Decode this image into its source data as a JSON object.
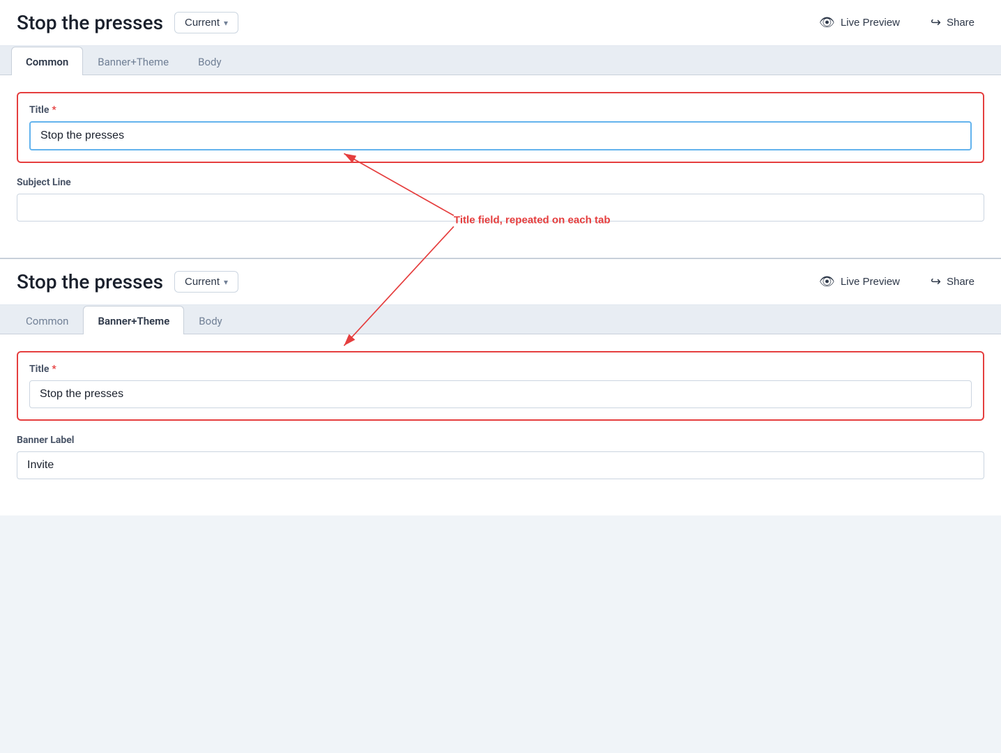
{
  "app": {
    "title": "Stop the presses"
  },
  "header": {
    "title": "Stop the presses",
    "version_label": "Current",
    "version_chevron": "▾",
    "live_preview_label": "Live Preview",
    "share_label": "Share"
  },
  "tabs": {
    "items": [
      {
        "id": "common",
        "label": "Common"
      },
      {
        "id": "banner_theme",
        "label": "Banner+Theme"
      },
      {
        "id": "body",
        "label": "Body"
      }
    ]
  },
  "top_panel": {
    "active_tab": "Common",
    "title_field": {
      "label": "Title",
      "required": true,
      "value": "Stop the presses",
      "placeholder": ""
    },
    "subject_line_field": {
      "label": "Subject Line",
      "value": "",
      "placeholder": ""
    }
  },
  "bottom_panel": {
    "active_tab": "Banner+Theme",
    "title_field": {
      "label": "Title",
      "required": true,
      "value": "Stop the presses",
      "placeholder": ""
    },
    "banner_label_field": {
      "label": "Banner Label",
      "value": "Invite",
      "placeholder": ""
    }
  },
  "annotation": {
    "text": "Title field, repeated on each tab",
    "color": "#e53e3e"
  }
}
